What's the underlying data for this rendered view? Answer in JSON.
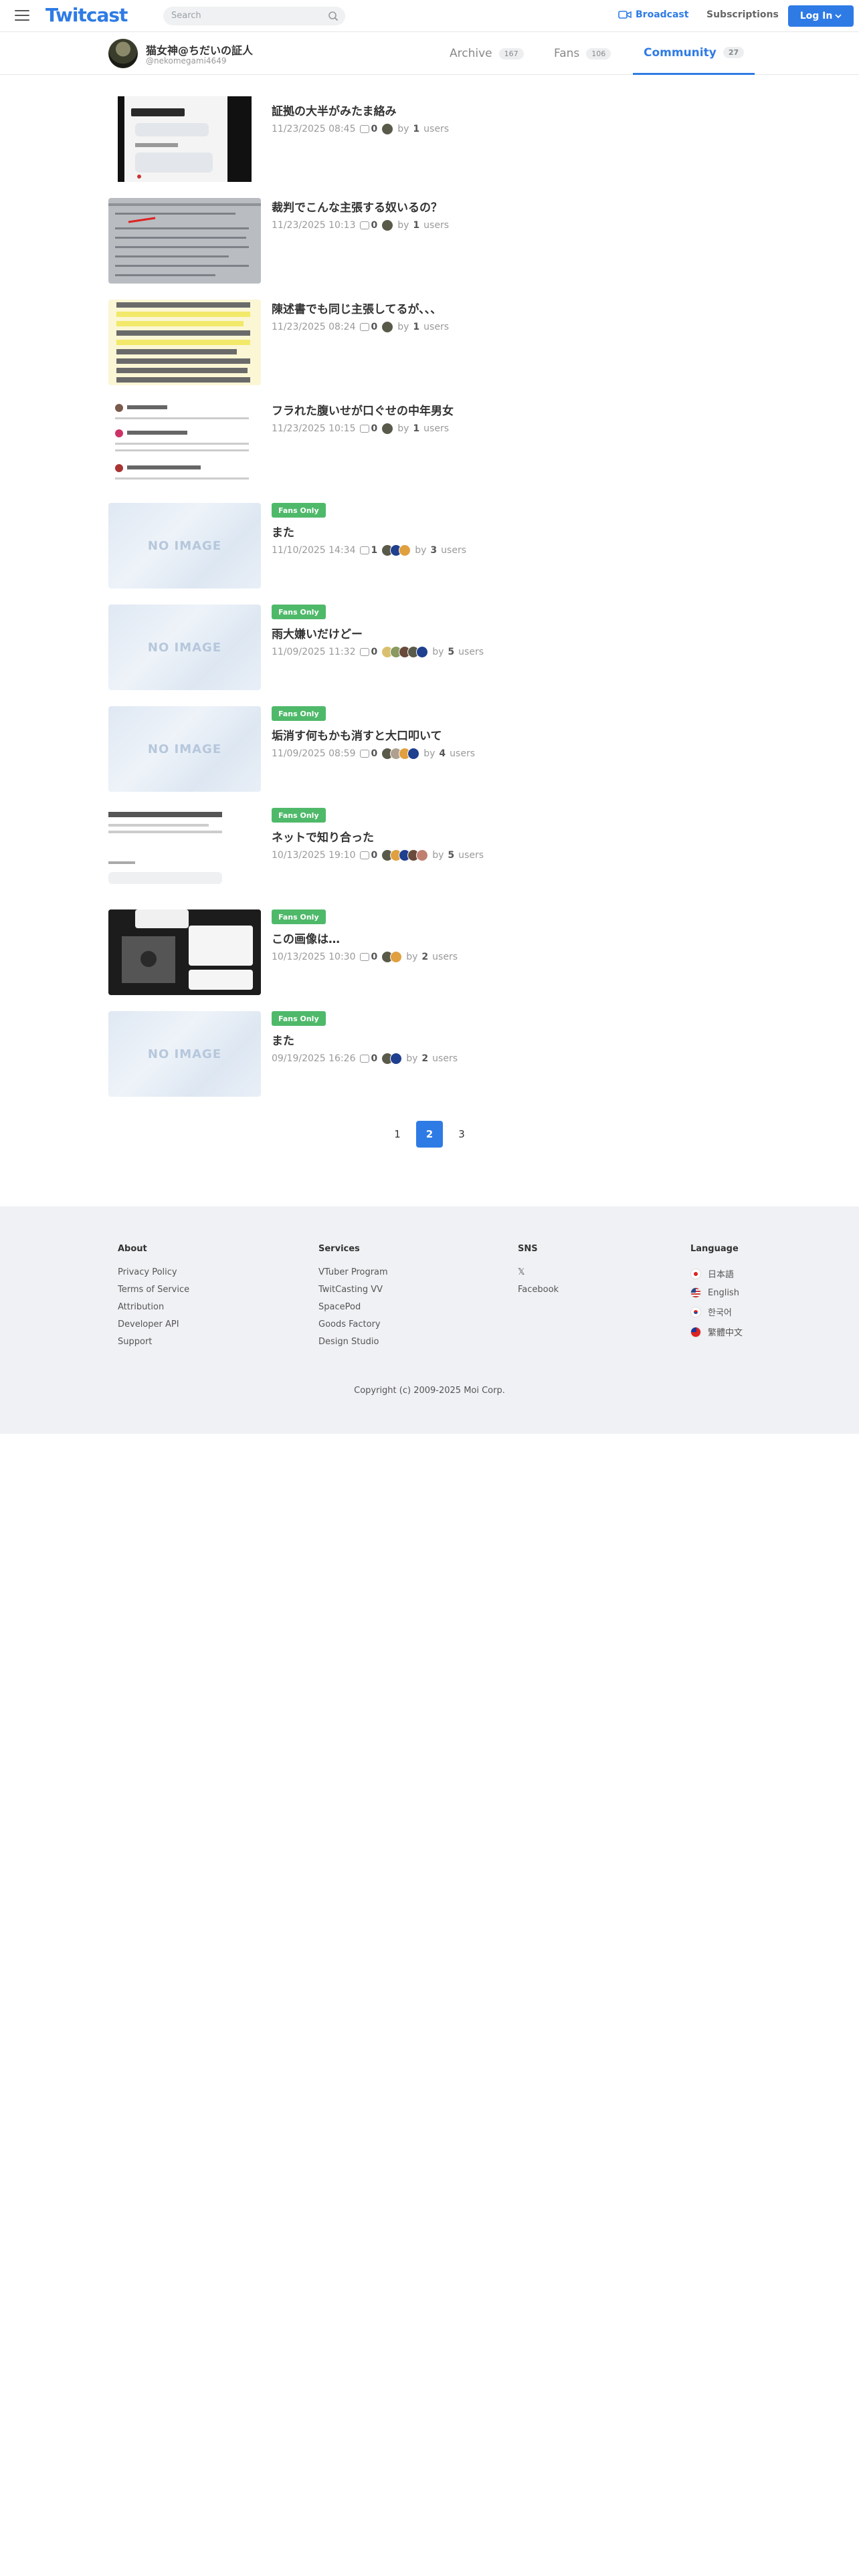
{
  "header": {
    "logo": "Twitcast",
    "search_placeholder": "Search",
    "broadcast_label": "Broadcast",
    "subscriptions_label": "Subscriptions",
    "login_label": "Log In",
    "accent_color": "#2f7be5"
  },
  "profile": {
    "name": "猫女神@ちだいの証人",
    "handle": "@nekomegami4649",
    "tabs": [
      {
        "label": "Archive",
        "count": "167",
        "active": false
      },
      {
        "label": "Fans",
        "count": "106",
        "active": false
      },
      {
        "label": "Community",
        "count": "27",
        "active": true
      }
    ]
  },
  "posts": [
    {
      "title": "証拠の大半がみたま絡み",
      "date": "11/23/2025 08:45",
      "comments": "0",
      "users": "1",
      "fans_only": false,
      "thumb": "phone-screenshot"
    },
    {
      "title": "裁判でこんな主張する奴いるの？",
      "date": "11/23/2025 10:13",
      "comments": "0",
      "users": "1",
      "fans_only": false,
      "thumb": "document-photo"
    },
    {
      "title": "陳述書でも同じ主張してるが、、、",
      "date": "11/23/2025 08:24",
      "comments": "0",
      "users": "1",
      "fans_only": false,
      "thumb": "highlighted-text"
    },
    {
      "title": "フラれた腹いせが口ぐせの中年男女",
      "date": "11/23/2025 10:15",
      "comments": "0",
      "users": "1",
      "fans_only": false,
      "thumb": "social-feed"
    },
    {
      "title": "また",
      "date": "11/10/2025 14:34",
      "comments": "1",
      "users": "3",
      "fans_only": true,
      "thumb": "no-image"
    },
    {
      "title": "雨大嫌いだけどー",
      "date": "11/09/2025 11:32",
      "comments": "0",
      "users": "5",
      "fans_only": true,
      "thumb": "no-image"
    },
    {
      "title": "垢消す何もかも消すと大口叩いて",
      "date": "11/09/2025 08:59",
      "comments": "0",
      "users": "4",
      "fans_only": true,
      "thumb": "no-image"
    },
    {
      "title": "ネットで知り合った",
      "date": "10/13/2025 19:10",
      "comments": "0",
      "users": "5",
      "fans_only": true,
      "thumb": "chat-screenshot"
    },
    {
      "title": "この画像は…",
      "date": "10/13/2025 10:30",
      "comments": "0",
      "users": "2",
      "fans_only": true,
      "thumb": "dark-photo"
    },
    {
      "title": "また",
      "date": "09/19/2025 16:26",
      "comments": "0",
      "users": "2",
      "fans_only": true,
      "thumb": "no-image"
    }
  ],
  "labels": {
    "fans_only": "Fans Only",
    "by": "by",
    "users": "users",
    "no_image": "NO IMAGE"
  },
  "pagination": {
    "pages": [
      "1",
      "2",
      "3"
    ],
    "current": "2"
  },
  "footer": {
    "about": {
      "title": "About",
      "links": [
        "Privacy Policy",
        "Terms of Service",
        "Attribution",
        "Developer API",
        "Support"
      ]
    },
    "services": {
      "title": "Services",
      "links": [
        "VTuber Program",
        "TwitCasting VV",
        "SpacePod",
        "Goods Factory",
        "Design Studio"
      ]
    },
    "sns": {
      "title": "SNS",
      "links": [
        "𝕏",
        "Facebook"
      ]
    },
    "language": {
      "title": "Language",
      "links": [
        "日本語",
        "English",
        "한국어",
        "繁體中文"
      ]
    },
    "copyright": "Copyright (c) 2009-2025 Moi Corp."
  }
}
